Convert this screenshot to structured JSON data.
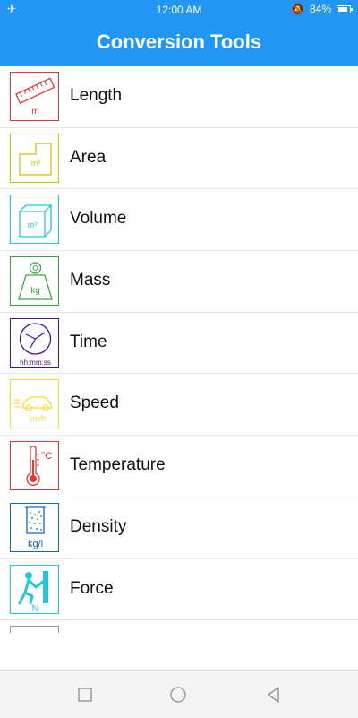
{
  "status": {
    "time": "12:00 AM",
    "battery": "84%",
    "battery_level": 0.84
  },
  "header": {
    "title": "Conversion Tools"
  },
  "items": [
    {
      "label": "Length",
      "icon": "ruler-icon",
      "icon_text": "m",
      "color": "#e53935"
    },
    {
      "label": "Area",
      "icon": "area-icon",
      "icon_text": "m²",
      "color": "#d4c200"
    },
    {
      "label": "Volume",
      "icon": "volume-cube-icon",
      "icon_text": "m³",
      "color": "#26c6da"
    },
    {
      "label": "Mass",
      "icon": "weight-icon",
      "icon_text": "kg",
      "color": "#43a047"
    },
    {
      "label": "Time",
      "icon": "clock-icon",
      "icon_text": "hh:mm:ss",
      "color": "#4a148c"
    },
    {
      "label": "Speed",
      "icon": "car-speed-icon",
      "icon_text": "km/h",
      "color": "#fdd835"
    },
    {
      "label": "Temperature",
      "icon": "thermometer-icon",
      "icon_text": "°C",
      "color": "#e53935"
    },
    {
      "label": "Density",
      "icon": "density-jar-icon",
      "icon_text": "kg/l",
      "color": "#1565c0"
    },
    {
      "label": "Force",
      "icon": "force-push-icon",
      "icon_text": "N",
      "color": "#26c6da"
    }
  ]
}
